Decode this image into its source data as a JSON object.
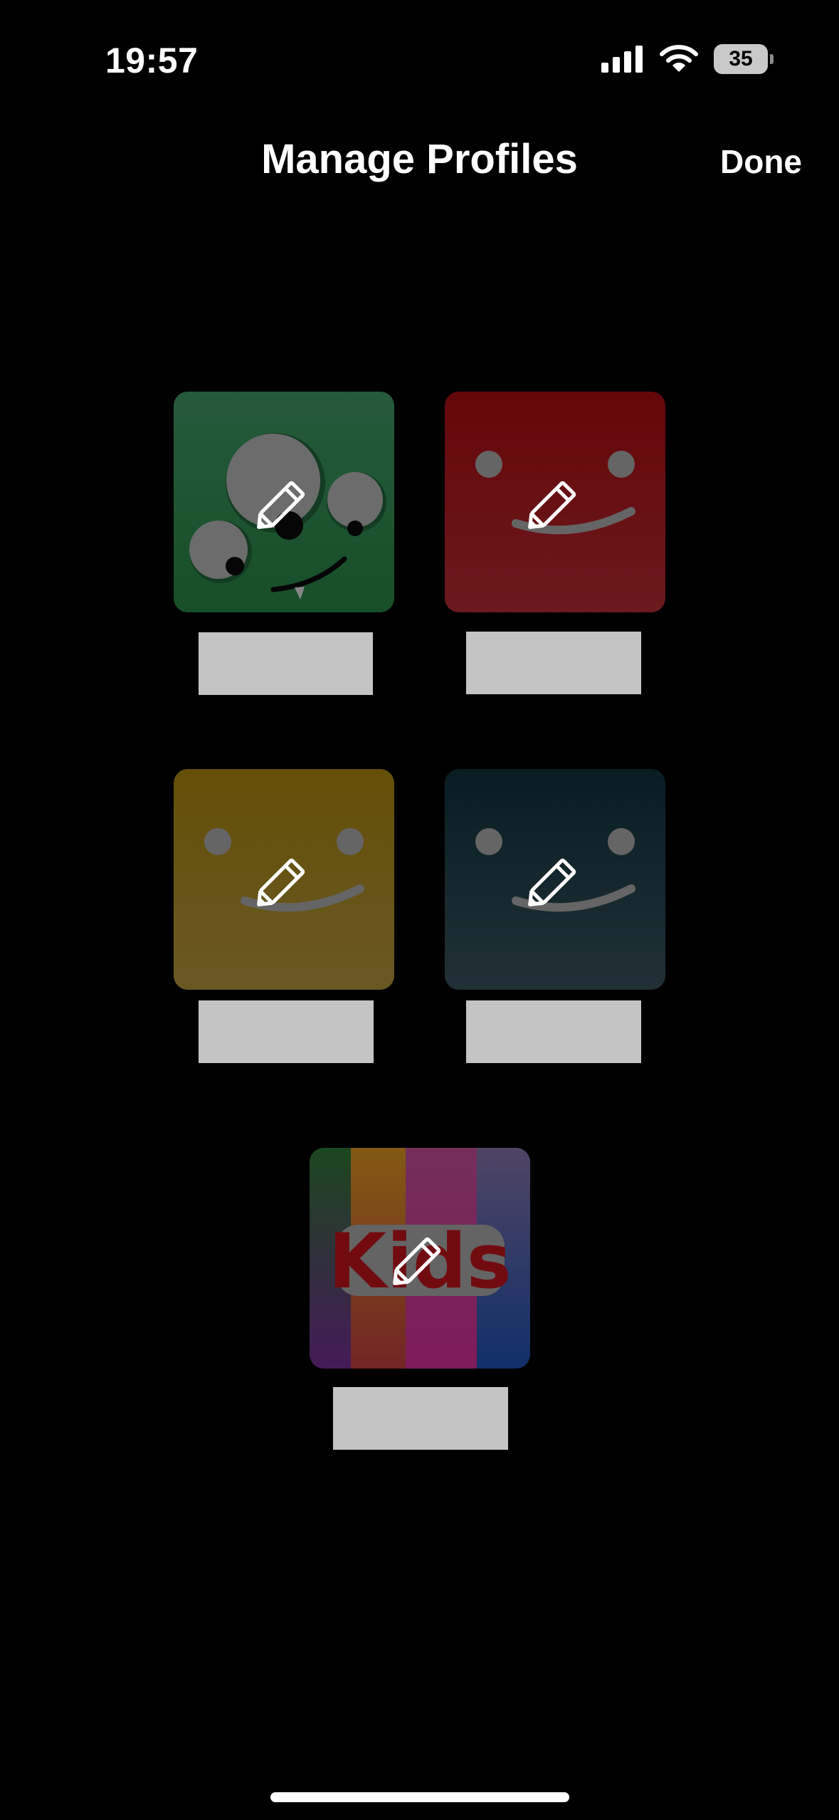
{
  "status_bar": {
    "time": "19:57",
    "battery": "35",
    "icons": [
      "signal-icon",
      "wifi-icon",
      "battery-icon"
    ]
  },
  "header": {
    "title": "Manage Profiles",
    "done_label": "Done"
  },
  "profiles": [
    {
      "avatar": "green-monster-avatar",
      "color": "#2e6b44",
      "name": ""
    },
    {
      "avatar": "red-smile-avatar",
      "color": "#9b0c12",
      "name": ""
    },
    {
      "avatar": "yellow-smile-avatar",
      "color": "#9a7a10",
      "name": ""
    },
    {
      "avatar": "navy-smile-avatar",
      "color": "#12323c",
      "name": ""
    },
    {
      "avatar": "kids-avatar",
      "label": "Kids",
      "color": "#b0121a",
      "name": ""
    }
  ],
  "edit_icon": "pencil-icon"
}
